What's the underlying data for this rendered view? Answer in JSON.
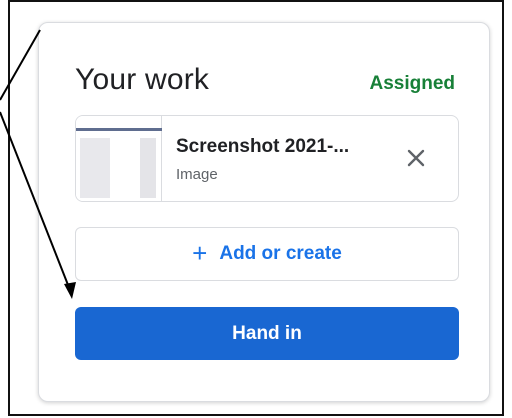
{
  "card": {
    "title": "Your work",
    "status": "Assigned",
    "status_color": "#188038"
  },
  "attachment": {
    "name": "Screenshot 2021-...",
    "type": "Image",
    "close_icon": "close-icon",
    "thumbnail_icon": "image-thumbnail"
  },
  "actions": {
    "add_icon": "plus-icon",
    "add_label": "Add or create",
    "add_color": "#1a73e8",
    "hand_in_label": "Hand in",
    "hand_in_color": "#1967d2"
  },
  "annotation": {
    "icon": "arrow-annotation"
  }
}
